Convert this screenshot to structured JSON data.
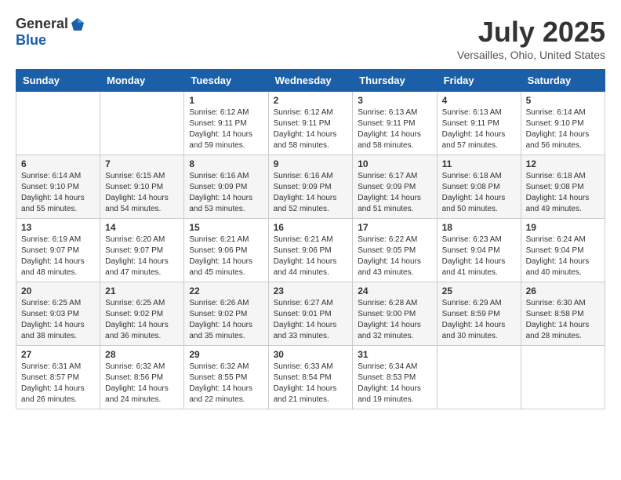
{
  "header": {
    "logo_general": "General",
    "logo_blue": "Blue",
    "month_year": "July 2025",
    "location": "Versailles, Ohio, United States"
  },
  "calendar": {
    "days_of_week": [
      "Sunday",
      "Monday",
      "Tuesday",
      "Wednesday",
      "Thursday",
      "Friday",
      "Saturday"
    ],
    "weeks": [
      [
        {
          "day": "",
          "info": ""
        },
        {
          "day": "",
          "info": ""
        },
        {
          "day": "1",
          "info": "Sunrise: 6:12 AM\nSunset: 9:11 PM\nDaylight: 14 hours\nand 59 minutes."
        },
        {
          "day": "2",
          "info": "Sunrise: 6:12 AM\nSunset: 9:11 PM\nDaylight: 14 hours\nand 58 minutes."
        },
        {
          "day": "3",
          "info": "Sunrise: 6:13 AM\nSunset: 9:11 PM\nDaylight: 14 hours\nand 58 minutes."
        },
        {
          "day": "4",
          "info": "Sunrise: 6:13 AM\nSunset: 9:11 PM\nDaylight: 14 hours\nand 57 minutes."
        },
        {
          "day": "5",
          "info": "Sunrise: 6:14 AM\nSunset: 9:10 PM\nDaylight: 14 hours\nand 56 minutes."
        }
      ],
      [
        {
          "day": "6",
          "info": "Sunrise: 6:14 AM\nSunset: 9:10 PM\nDaylight: 14 hours\nand 55 minutes."
        },
        {
          "day": "7",
          "info": "Sunrise: 6:15 AM\nSunset: 9:10 PM\nDaylight: 14 hours\nand 54 minutes."
        },
        {
          "day": "8",
          "info": "Sunrise: 6:16 AM\nSunset: 9:09 PM\nDaylight: 14 hours\nand 53 minutes."
        },
        {
          "day": "9",
          "info": "Sunrise: 6:16 AM\nSunset: 9:09 PM\nDaylight: 14 hours\nand 52 minutes."
        },
        {
          "day": "10",
          "info": "Sunrise: 6:17 AM\nSunset: 9:09 PM\nDaylight: 14 hours\nand 51 minutes."
        },
        {
          "day": "11",
          "info": "Sunrise: 6:18 AM\nSunset: 9:08 PM\nDaylight: 14 hours\nand 50 minutes."
        },
        {
          "day": "12",
          "info": "Sunrise: 6:18 AM\nSunset: 9:08 PM\nDaylight: 14 hours\nand 49 minutes."
        }
      ],
      [
        {
          "day": "13",
          "info": "Sunrise: 6:19 AM\nSunset: 9:07 PM\nDaylight: 14 hours\nand 48 minutes."
        },
        {
          "day": "14",
          "info": "Sunrise: 6:20 AM\nSunset: 9:07 PM\nDaylight: 14 hours\nand 47 minutes."
        },
        {
          "day": "15",
          "info": "Sunrise: 6:21 AM\nSunset: 9:06 PM\nDaylight: 14 hours\nand 45 minutes."
        },
        {
          "day": "16",
          "info": "Sunrise: 6:21 AM\nSunset: 9:06 PM\nDaylight: 14 hours\nand 44 minutes."
        },
        {
          "day": "17",
          "info": "Sunrise: 6:22 AM\nSunset: 9:05 PM\nDaylight: 14 hours\nand 43 minutes."
        },
        {
          "day": "18",
          "info": "Sunrise: 6:23 AM\nSunset: 9:04 PM\nDaylight: 14 hours\nand 41 minutes."
        },
        {
          "day": "19",
          "info": "Sunrise: 6:24 AM\nSunset: 9:04 PM\nDaylight: 14 hours\nand 40 minutes."
        }
      ],
      [
        {
          "day": "20",
          "info": "Sunrise: 6:25 AM\nSunset: 9:03 PM\nDaylight: 14 hours\nand 38 minutes."
        },
        {
          "day": "21",
          "info": "Sunrise: 6:25 AM\nSunset: 9:02 PM\nDaylight: 14 hours\nand 36 minutes."
        },
        {
          "day": "22",
          "info": "Sunrise: 6:26 AM\nSunset: 9:02 PM\nDaylight: 14 hours\nand 35 minutes."
        },
        {
          "day": "23",
          "info": "Sunrise: 6:27 AM\nSunset: 9:01 PM\nDaylight: 14 hours\nand 33 minutes."
        },
        {
          "day": "24",
          "info": "Sunrise: 6:28 AM\nSunset: 9:00 PM\nDaylight: 14 hours\nand 32 minutes."
        },
        {
          "day": "25",
          "info": "Sunrise: 6:29 AM\nSunset: 8:59 PM\nDaylight: 14 hours\nand 30 minutes."
        },
        {
          "day": "26",
          "info": "Sunrise: 6:30 AM\nSunset: 8:58 PM\nDaylight: 14 hours\nand 28 minutes."
        }
      ],
      [
        {
          "day": "27",
          "info": "Sunrise: 6:31 AM\nSunset: 8:57 PM\nDaylight: 14 hours\nand 26 minutes."
        },
        {
          "day": "28",
          "info": "Sunrise: 6:32 AM\nSunset: 8:56 PM\nDaylight: 14 hours\nand 24 minutes."
        },
        {
          "day": "29",
          "info": "Sunrise: 6:32 AM\nSunset: 8:55 PM\nDaylight: 14 hours\nand 22 minutes."
        },
        {
          "day": "30",
          "info": "Sunrise: 6:33 AM\nSunset: 8:54 PM\nDaylight: 14 hours\nand 21 minutes."
        },
        {
          "day": "31",
          "info": "Sunrise: 6:34 AM\nSunset: 8:53 PM\nDaylight: 14 hours\nand 19 minutes."
        },
        {
          "day": "",
          "info": ""
        },
        {
          "day": "",
          "info": ""
        }
      ]
    ]
  }
}
